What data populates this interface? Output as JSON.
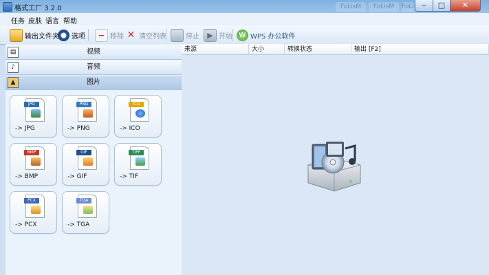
{
  "window": {
    "title": "格式工厂 3.2.0",
    "ghost_tabs": [
      "FoLisM",
      "FoLisM",
      "FoLis"
    ]
  },
  "menu": [
    "任务",
    "皮肤",
    "语言",
    "帮助"
  ],
  "toolbar": {
    "output_folder": "输出文件夹",
    "options": "选项",
    "remove": "移除",
    "clear_list": "清空列表",
    "stop": "停止",
    "start": "开始",
    "wps": "WPS 办公软件"
  },
  "categories": [
    "视频",
    "音频",
    "图片"
  ],
  "formats": [
    {
      "tag": "JPG",
      "label": "-> JPG"
    },
    {
      "tag": "PNG",
      "label": "-> PNG"
    },
    {
      "tag": "ICO",
      "label": "-> ICO"
    },
    {
      "tag": "BMP",
      "label": "-> BMP"
    },
    {
      "tag": "GIF",
      "label": "-> GIF"
    },
    {
      "tag": "TIFF",
      "label": "-> TIF"
    },
    {
      "tag": "PCX",
      "label": "-> PCX"
    },
    {
      "tag": "TGA",
      "label": "-> TGA"
    }
  ],
  "columns": [
    "来源",
    "大小",
    "转换状态",
    "输出 [F2]"
  ],
  "colors": {
    "jpg": "#2b6cb0",
    "png": "#2f7bc3",
    "ico": "#e0a800",
    "bmp": "#c0392b",
    "gif": "#1f4f8a",
    "tiff": "#2e8b57",
    "pcx": "#3a68b8",
    "tga": "#6a8bd6"
  }
}
